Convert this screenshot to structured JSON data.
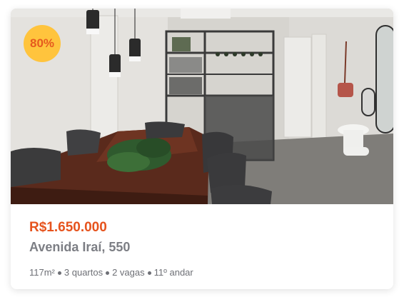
{
  "listing": {
    "discount_badge": "80%",
    "price": "R$1.650.000",
    "address": "Avenida Iraí, 550",
    "details": {
      "area": "117m²",
      "bedrooms": "3 quartos",
      "parking": "2 vagas",
      "floor": "11º andar"
    }
  },
  "colors": {
    "price": "#e6531d",
    "badge_bg": "#ffc43d",
    "badge_text": "#e65a1e"
  }
}
